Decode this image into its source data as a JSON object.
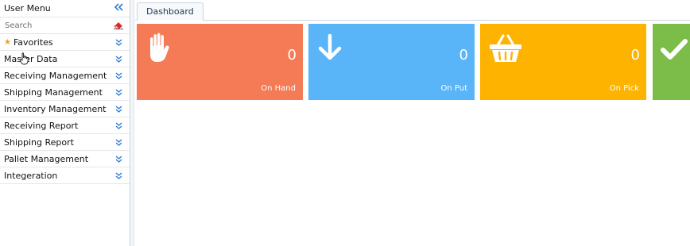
{
  "sidebar": {
    "title": "User Menu",
    "search_placeholder": "Search",
    "items": [
      {
        "label": "Favorites",
        "starred": true
      },
      {
        "label": "Master Data"
      },
      {
        "label": "Receiving Management"
      },
      {
        "label": "Shipping Management"
      },
      {
        "label": "Inventory Management"
      },
      {
        "label": "Receiving Report"
      },
      {
        "label": "Shipping Report"
      },
      {
        "label": "Pallet Management"
      },
      {
        "label": "Integeration"
      }
    ]
  },
  "tabs": [
    {
      "label": "Dashboard"
    }
  ],
  "tiles": [
    {
      "count": "0",
      "label": "On Hand",
      "color": "#f47b55",
      "icon": "hand-icon"
    },
    {
      "count": "0",
      "label": "On Put",
      "color": "#5ab4f8",
      "icon": "arrow-down-icon"
    },
    {
      "count": "0",
      "label": "On Pick",
      "color": "#fdb300",
      "icon": "basket-icon"
    },
    {
      "count": "",
      "label": "",
      "color": "#7cbd4a",
      "icon": "check-icon"
    }
  ],
  "colors": {
    "accent": "#2a7bd6",
    "star": "#f0a11a",
    "eraser": "#e0262a"
  }
}
